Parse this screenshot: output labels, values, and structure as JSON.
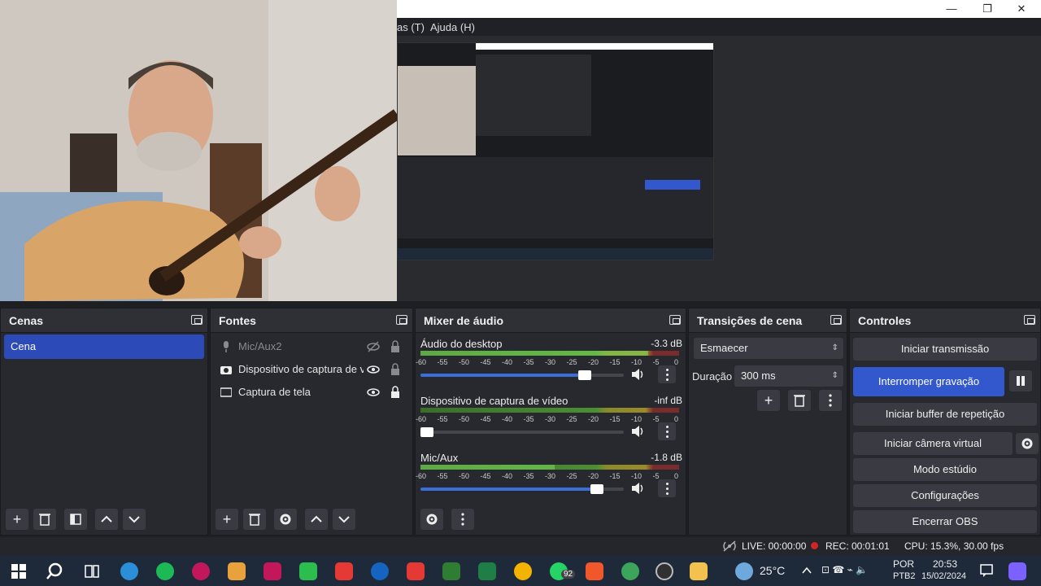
{
  "window": {
    "menu": [
      "as (T)",
      "Ajuda (H)"
    ],
    "minimize": "—",
    "maximize": "❐",
    "close": "✕"
  },
  "docks": {
    "scenes": {
      "title": "Cenas",
      "items": [
        "Cena"
      ]
    },
    "sources": {
      "title": "Fontes",
      "items": [
        {
          "label": "Mic/Aux2",
          "icon": "mic-icon",
          "visible": false
        },
        {
          "label": "Dispositivo de captura de ví",
          "icon": "camera-icon",
          "visible": true
        },
        {
          "label": "Captura de tela",
          "icon": "monitor-icon",
          "visible": true
        }
      ]
    },
    "mixer": {
      "title": "Mixer de áudio",
      "tick_labels": [
        "-60",
        "-55",
        "-50",
        "-45",
        "-40",
        "-35",
        "-30",
        "-25",
        "-20",
        "-15",
        "-10",
        "-5",
        "0"
      ],
      "channels": [
        {
          "name": "Áudio do desktop",
          "db": "-3.3 dB",
          "level": 0.88,
          "volume": 0.84
        },
        {
          "name": "Dispositivo de captura de vídeo",
          "db": "-inf dB",
          "level": 0.0,
          "volume": 0.04
        },
        {
          "name": "Mic/Aux",
          "db": "-1.8 dB",
          "level": 0.52,
          "volume": 0.9
        }
      ]
    },
    "transitions": {
      "title": "Transições de cena",
      "selected": "Esmaecer",
      "duration_label": "Duração",
      "duration_value": "300 ms"
    },
    "controls": {
      "title": "Controles",
      "start_stream": "Iniciar transmissão",
      "stop_recording": "Interromper gravação",
      "replay_buffer": "Iniciar buffer de repetição",
      "virtual_cam": "Iniciar câmera virtual",
      "studio_mode": "Modo estúdio",
      "settings": "Configurações",
      "exit": "Encerrar OBS"
    }
  },
  "status": {
    "live": "LIVE: 00:00:00",
    "rec": "REC: 00:01:01",
    "cpu": "CPU: 15.3%, 30.00 fps"
  },
  "taskbar": {
    "weather": "25°C",
    "lang_top": "POR",
    "lang_bottom": "PTB2",
    "time": "20:53",
    "date": "15/02/2024",
    "badge": "92"
  },
  "colors": {
    "accent": "#3357cc",
    "rec": "#d02525"
  }
}
